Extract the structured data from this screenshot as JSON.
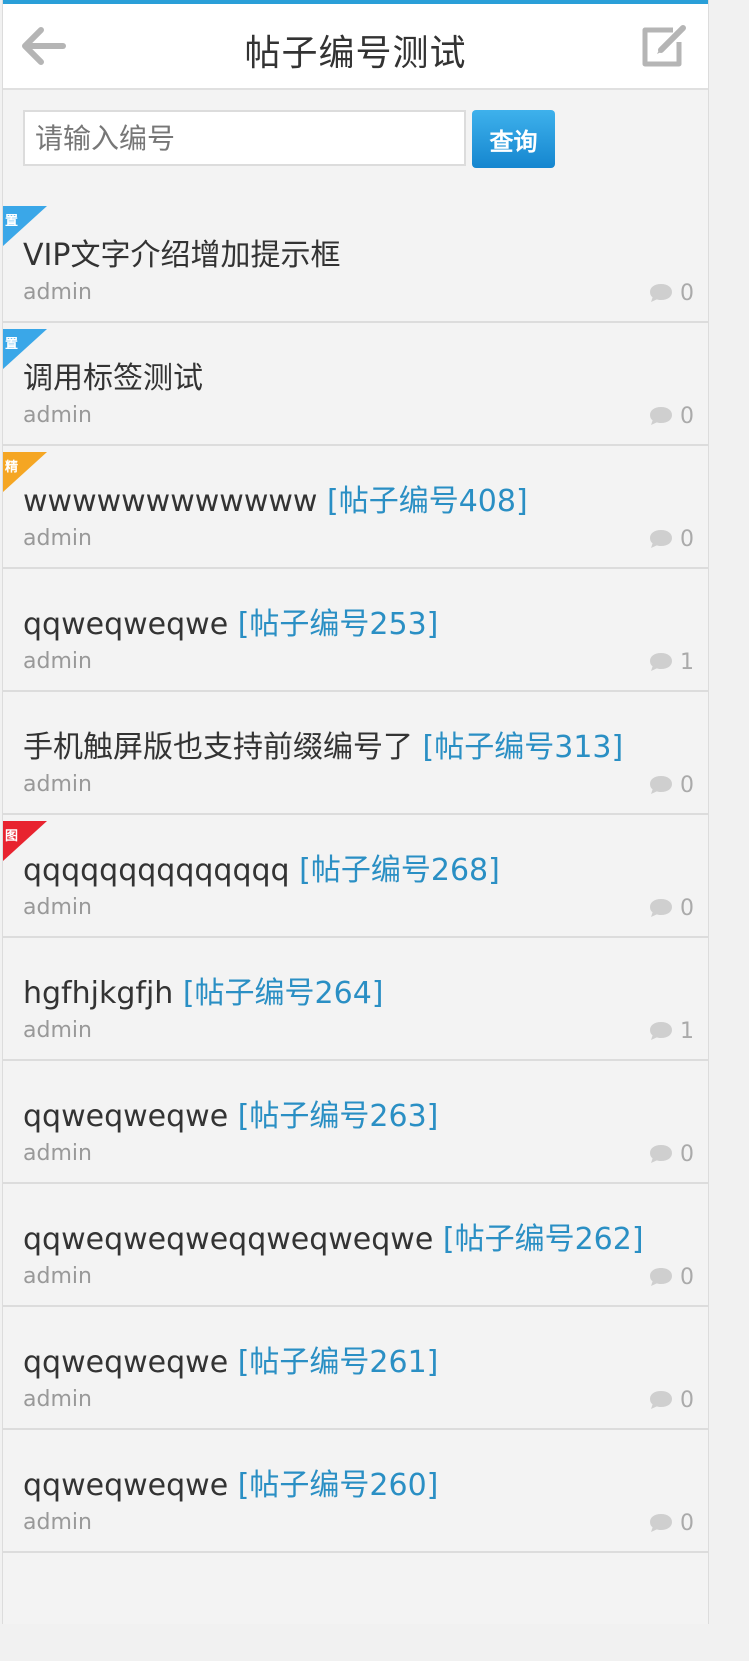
{
  "header": {
    "title": "帖子编号测试",
    "back_icon": "arrow-left-icon",
    "compose_icon": "compose-icon"
  },
  "search": {
    "placeholder": "请输入编号",
    "button_label": "查询"
  },
  "threads": [
    {
      "badge": "置",
      "badge_color": "#3aa7e8",
      "title": "VIP文字介绍增加提示框",
      "tag": "",
      "author": "admin",
      "replies": "0"
    },
    {
      "badge": "置",
      "badge_color": "#3aa7e8",
      "title": "调用标签测试",
      "tag": "",
      "author": "admin",
      "replies": "0"
    },
    {
      "badge": "精",
      "badge_color": "#f5a623",
      "title": "wwwwwwwwwwww",
      "tag": "[帖子编号408]",
      "author": "admin",
      "replies": "0"
    },
    {
      "badge": "",
      "badge_color": "",
      "title": "qqweqweqwe",
      "tag": "[帖子编号253]",
      "author": "admin",
      "replies": "1"
    },
    {
      "badge": "",
      "badge_color": "",
      "title": "手机触屏版也支持前缀编号了",
      "tag": "[帖子编号313]",
      "author": "admin",
      "replies": "0"
    },
    {
      "badge": "图",
      "badge_color": "#e8232f",
      "title": "qqqqqqqqqqqqqq",
      "tag": "[帖子编号268]",
      "author": "admin",
      "replies": "0"
    },
    {
      "badge": "",
      "badge_color": "",
      "title": "hgfhjkgfjh",
      "tag": "[帖子编号264]",
      "author": "admin",
      "replies": "1"
    },
    {
      "badge": "",
      "badge_color": "",
      "title": "qqweqweqwe",
      "tag": "[帖子编号263]",
      "author": "admin",
      "replies": "0"
    },
    {
      "badge": "",
      "badge_color": "",
      "title": "qqweqweqweqqweqweqwe",
      "tag": "[帖子编号262]",
      "author": "admin",
      "replies": "0"
    },
    {
      "badge": "",
      "badge_color": "",
      "title": "qqweqweqwe",
      "tag": "[帖子编号261]",
      "author": "admin",
      "replies": "0"
    },
    {
      "badge": "",
      "badge_color": "",
      "title": "qqweqweqwe",
      "tag": "[帖子编号260]",
      "author": "admin",
      "replies": "0"
    }
  ],
  "colors": {
    "accent": "#2a9fd8",
    "tag": "#2a8fc4"
  }
}
